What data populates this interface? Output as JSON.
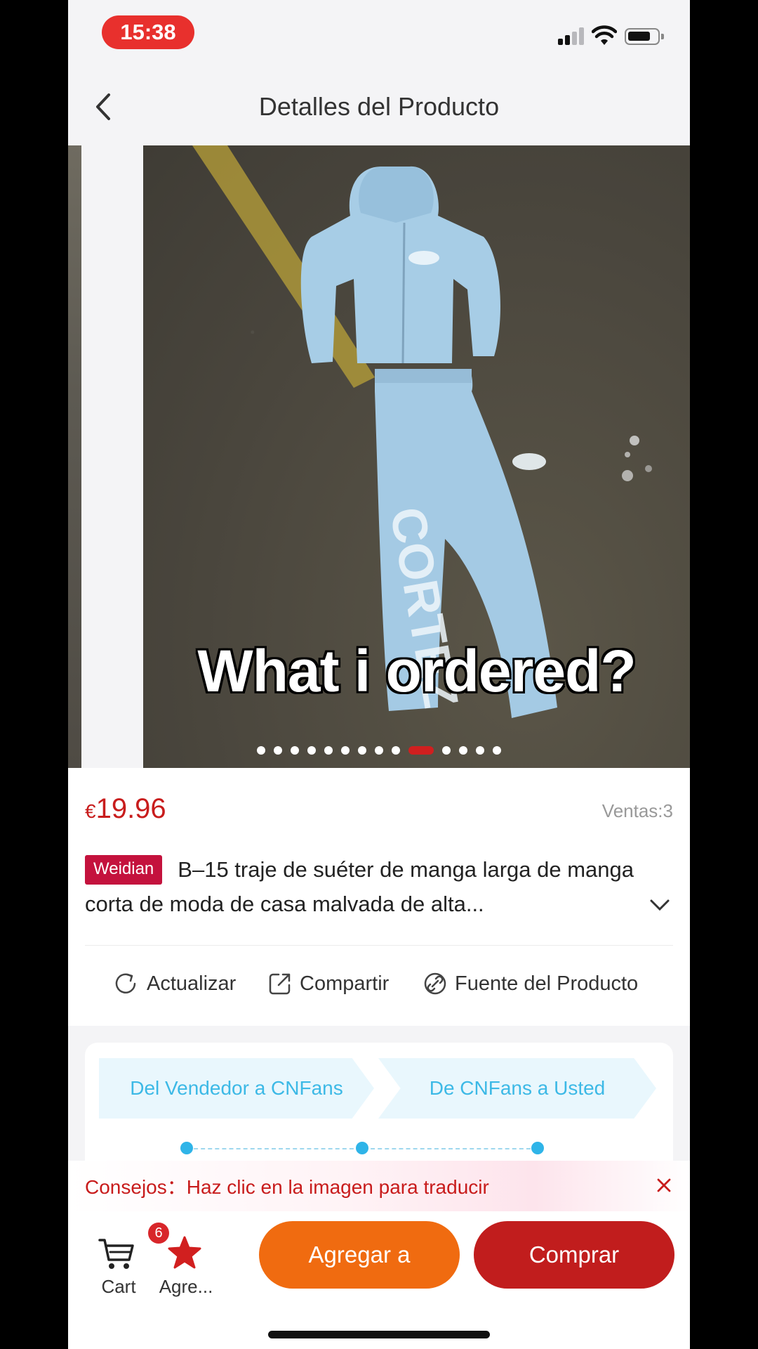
{
  "status_bar": {
    "time": "15:38"
  },
  "nav": {
    "title": "Detalles del Producto"
  },
  "gallery": {
    "caption": "What i ordered?",
    "dot_count": 14,
    "active_index": 9
  },
  "product": {
    "currency": "€",
    "price": "19.96",
    "sales": "Ventas:3",
    "badge": "Weidian",
    "title": "B–15 traje de suéter de manga larga de manga corta de moda de casa malvada de alta..."
  },
  "actions": {
    "refresh": "Actualizar",
    "share": "Compartir",
    "source": "Fuente del Producto"
  },
  "shipping": {
    "step1": "Del Vendedor a CNFans",
    "step2": "De CNFans a Usted"
  },
  "tip": {
    "text": "Consejos：Haz clic en la imagen para traducir"
  },
  "bottom_bar": {
    "cart_label": "Cart",
    "cart_count": "6",
    "fav_label": "Agre...",
    "add_label": "Agregar a",
    "buy_label": "Comprar"
  },
  "colors": {
    "accent_red": "#c11d1d",
    "orange": "#f06b10",
    "shipping_blue": "#3cb9e6",
    "badge": "#c4123d"
  },
  "icons": [
    "back-icon",
    "refresh-icon",
    "share-icon",
    "link-icon",
    "chevron-down-icon",
    "close-icon",
    "cart-icon",
    "star-icon",
    "wifi-icon",
    "battery-icon",
    "signal-icon"
  ]
}
